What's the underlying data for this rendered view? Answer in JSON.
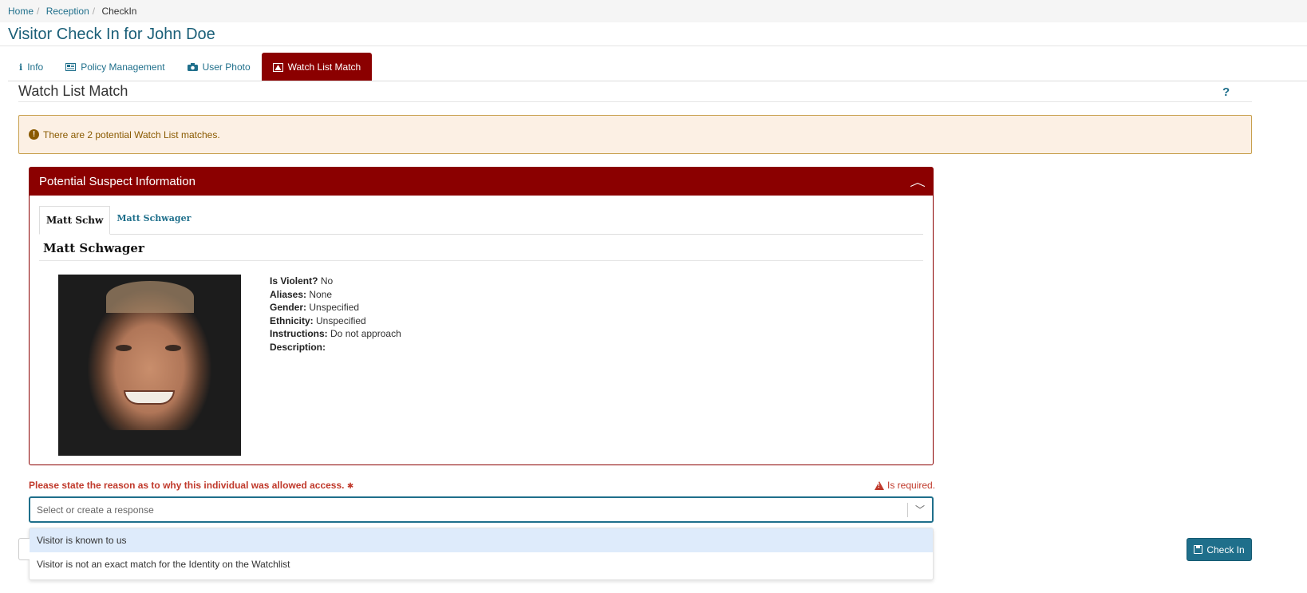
{
  "breadcrumb": {
    "items": [
      "Home",
      "Reception"
    ],
    "current": "CheckIn"
  },
  "page": {
    "title": "Visitor Check In for John Doe"
  },
  "tabs": [
    {
      "label": "Info",
      "icon": "info-icon"
    },
    {
      "label": "Policy Management",
      "icon": "newspaper-icon"
    },
    {
      "label": "User Photo",
      "icon": "camera-icon"
    },
    {
      "label": "Watch List Match",
      "icon": "warning-icon",
      "active": true
    }
  ],
  "section": {
    "title": "Watch List Match",
    "help": "?"
  },
  "alert": {
    "icon": "exclamation-circle-icon",
    "text": "There are 2 potential Watch List matches."
  },
  "panel": {
    "title": "Potential Suspect Information",
    "subtabs": [
      "Matt Schw",
      "Matt Schwager"
    ],
    "suspect": {
      "name": "Matt Schwager",
      "fields": [
        {
          "label": "Is Violent?",
          "value": "No"
        },
        {
          "label": "Aliases:",
          "value": "None"
        },
        {
          "label": "Gender:",
          "value": "Unspecified"
        },
        {
          "label": "Ethnicity:",
          "value": "Unspecified"
        },
        {
          "label": "Instructions:",
          "value": "Do not approach"
        },
        {
          "label": "Description:",
          "value": ""
        }
      ]
    }
  },
  "reason": {
    "label": "Please state the reason as to why this individual was allowed access.",
    "required_marker": "✱",
    "required_msg": "Is required.",
    "placeholder": "Select or create a response",
    "options": [
      "Visitor is known to us",
      "Visitor is not an exact match for the Identity on the Watchlist"
    ]
  },
  "actions": {
    "checkin_label": "Check In"
  },
  "colors": {
    "brand": "#1f6f8b",
    "danger": "#8b0000",
    "alert_bg": "#fcf0e4"
  }
}
